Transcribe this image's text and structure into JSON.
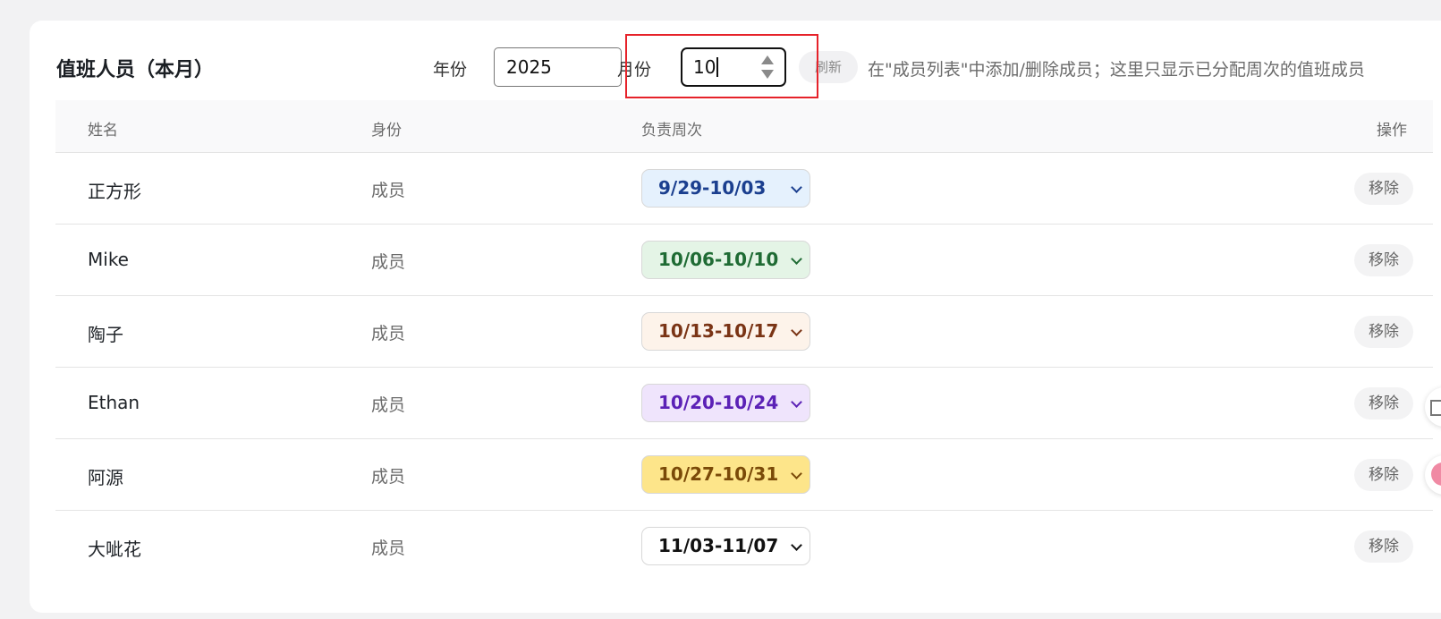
{
  "header": {
    "title": "值班人员（本月）",
    "year_label": "年份",
    "year_value": "2025",
    "month_label": "月份",
    "month_value": "10",
    "refresh_label": "刷新",
    "hint": "在\"成员列表\"中添加/删除成员；这里只显示已分配周次的值班成员"
  },
  "table": {
    "columns": [
      "姓名",
      "身份",
      "负责周次",
      "操作"
    ],
    "rows": [
      {
        "name": "正方形",
        "role": "成员",
        "week": "9/29-10/03",
        "action": "移除"
      },
      {
        "name": "Mike",
        "role": "成员",
        "week": "10/06-10/10",
        "action": "移除"
      },
      {
        "name": "陶子",
        "role": "成员",
        "week": "10/13-10/17",
        "action": "移除"
      },
      {
        "name": "Ethan",
        "role": "成员",
        "week": "10/20-10/24",
        "action": "移除"
      },
      {
        "name": "阿源",
        "role": "成员",
        "week": "10/27-10/31",
        "action": "移除"
      },
      {
        "name": "大呲花",
        "role": "成员",
        "week": "11/03-11/07",
        "action": "移除"
      }
    ]
  },
  "colors": {
    "highlight_border": "#e6222a",
    "week_styles": [
      {
        "bg": "#e5f1fd",
        "fg": "#1b3f8f"
      },
      {
        "bg": "#e4f4e6",
        "fg": "#1f6b34"
      },
      {
        "bg": "#fdf3ea",
        "fg": "#7a3415"
      },
      {
        "bg": "#efe4fc",
        "fg": "#5b21b6"
      },
      {
        "bg": "#fde58a",
        "fg": "#7a4a08"
      },
      {
        "bg": "#ffffff",
        "fg": "#111111"
      }
    ]
  }
}
